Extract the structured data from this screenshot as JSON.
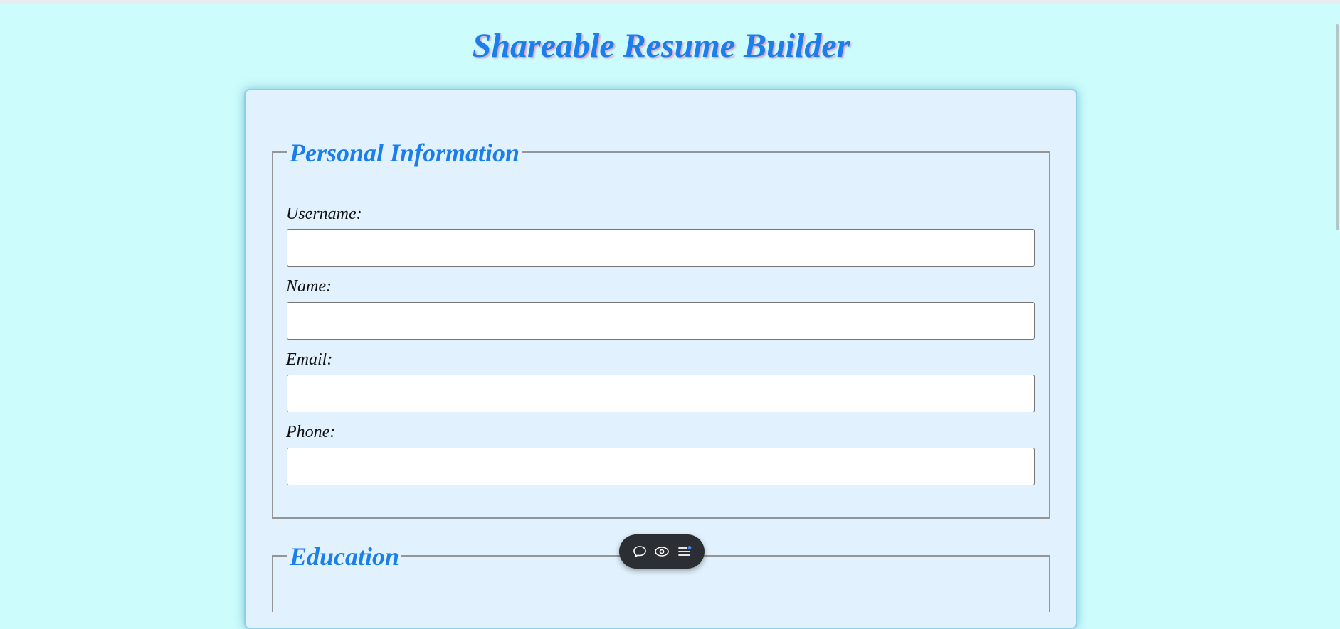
{
  "app": {
    "title": "Shareable Resume Builder"
  },
  "sections": {
    "personal": {
      "legend": "Personal Information",
      "fields": {
        "username": {
          "label": "Username:",
          "value": "",
          "placeholder": ""
        },
        "name": {
          "label": "Name:",
          "value": "",
          "placeholder": ""
        },
        "email": {
          "label": "Email:",
          "value": "",
          "placeholder": ""
        },
        "phone": {
          "label": "Phone:",
          "value": "",
          "placeholder": ""
        }
      }
    },
    "education": {
      "legend": "Education"
    }
  },
  "toolbar": {
    "buttons": [
      {
        "icon": "comment-icon"
      },
      {
        "icon": "eye-icon"
      },
      {
        "icon": "menu-list-icon"
      }
    ],
    "badge_color": "#3d8bfd"
  },
  "colors": {
    "background": "#ccfcfc",
    "card": "#e1f1fd",
    "accent": "#1a7fea",
    "toolbar": "#2b2f33"
  }
}
